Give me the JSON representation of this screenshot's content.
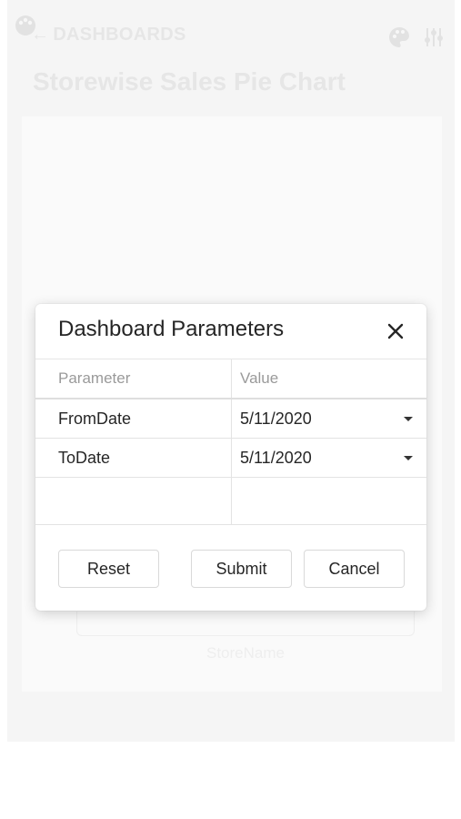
{
  "background": {
    "back_label": "DASHBOARDS",
    "back_arrow": "←",
    "title": "Storewise Sales Pie Chart",
    "axis_label": "StoreName",
    "icons": [
      "app-logo-icon",
      "palette-icon",
      "filter-settings-icon"
    ]
  },
  "dialog": {
    "title": "Dashboard Parameters",
    "close_icon": "close-icon",
    "columns": {
      "parameter": "Parameter",
      "value": "Value"
    },
    "rows": [
      {
        "parameter": "FromDate",
        "value": "5/11/2020"
      },
      {
        "parameter": "ToDate",
        "value": "5/11/2020"
      }
    ],
    "buttons": {
      "reset": "Reset",
      "submit": "Submit",
      "cancel": "Cancel"
    }
  },
  "colors": {
    "text_primary": "#262626",
    "text_header": "#9a9a9a",
    "border": "#e3e3e3",
    "faded_background_text": "#e6e6e6"
  }
}
